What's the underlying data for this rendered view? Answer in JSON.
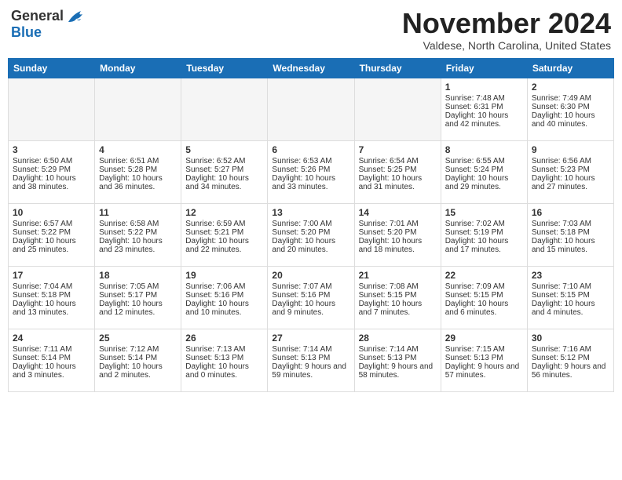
{
  "header": {
    "logo_general": "General",
    "logo_blue": "Blue",
    "month_title": "November 2024",
    "location": "Valdese, North Carolina, United States"
  },
  "weekdays": [
    "Sunday",
    "Monday",
    "Tuesday",
    "Wednesday",
    "Thursday",
    "Friday",
    "Saturday"
  ],
  "weeks": [
    [
      {
        "day": "",
        "sunrise": "",
        "sunset": "",
        "daylight": "",
        "empty": true
      },
      {
        "day": "",
        "sunrise": "",
        "sunset": "",
        "daylight": "",
        "empty": true
      },
      {
        "day": "",
        "sunrise": "",
        "sunset": "",
        "daylight": "",
        "empty": true
      },
      {
        "day": "",
        "sunrise": "",
        "sunset": "",
        "daylight": "",
        "empty": true
      },
      {
        "day": "",
        "sunrise": "",
        "sunset": "",
        "daylight": "",
        "empty": true
      },
      {
        "day": "1",
        "sunrise": "Sunrise: 7:48 AM",
        "sunset": "Sunset: 6:31 PM",
        "daylight": "Daylight: 10 hours and 42 minutes.",
        "empty": false
      },
      {
        "day": "2",
        "sunrise": "Sunrise: 7:49 AM",
        "sunset": "Sunset: 6:30 PM",
        "daylight": "Daylight: 10 hours and 40 minutes.",
        "empty": false
      }
    ],
    [
      {
        "day": "3",
        "sunrise": "Sunrise: 6:50 AM",
        "sunset": "Sunset: 5:29 PM",
        "daylight": "Daylight: 10 hours and 38 minutes.",
        "empty": false
      },
      {
        "day": "4",
        "sunrise": "Sunrise: 6:51 AM",
        "sunset": "Sunset: 5:28 PM",
        "daylight": "Daylight: 10 hours and 36 minutes.",
        "empty": false
      },
      {
        "day": "5",
        "sunrise": "Sunrise: 6:52 AM",
        "sunset": "Sunset: 5:27 PM",
        "daylight": "Daylight: 10 hours and 34 minutes.",
        "empty": false
      },
      {
        "day": "6",
        "sunrise": "Sunrise: 6:53 AM",
        "sunset": "Sunset: 5:26 PM",
        "daylight": "Daylight: 10 hours and 33 minutes.",
        "empty": false
      },
      {
        "day": "7",
        "sunrise": "Sunrise: 6:54 AM",
        "sunset": "Sunset: 5:25 PM",
        "daylight": "Daylight: 10 hours and 31 minutes.",
        "empty": false
      },
      {
        "day": "8",
        "sunrise": "Sunrise: 6:55 AM",
        "sunset": "Sunset: 5:24 PM",
        "daylight": "Daylight: 10 hours and 29 minutes.",
        "empty": false
      },
      {
        "day": "9",
        "sunrise": "Sunrise: 6:56 AM",
        "sunset": "Sunset: 5:23 PM",
        "daylight": "Daylight: 10 hours and 27 minutes.",
        "empty": false
      }
    ],
    [
      {
        "day": "10",
        "sunrise": "Sunrise: 6:57 AM",
        "sunset": "Sunset: 5:22 PM",
        "daylight": "Daylight: 10 hours and 25 minutes.",
        "empty": false
      },
      {
        "day": "11",
        "sunrise": "Sunrise: 6:58 AM",
        "sunset": "Sunset: 5:22 PM",
        "daylight": "Daylight: 10 hours and 23 minutes.",
        "empty": false
      },
      {
        "day": "12",
        "sunrise": "Sunrise: 6:59 AM",
        "sunset": "Sunset: 5:21 PM",
        "daylight": "Daylight: 10 hours and 22 minutes.",
        "empty": false
      },
      {
        "day": "13",
        "sunrise": "Sunrise: 7:00 AM",
        "sunset": "Sunset: 5:20 PM",
        "daylight": "Daylight: 10 hours and 20 minutes.",
        "empty": false
      },
      {
        "day": "14",
        "sunrise": "Sunrise: 7:01 AM",
        "sunset": "Sunset: 5:20 PM",
        "daylight": "Daylight: 10 hours and 18 minutes.",
        "empty": false
      },
      {
        "day": "15",
        "sunrise": "Sunrise: 7:02 AM",
        "sunset": "Sunset: 5:19 PM",
        "daylight": "Daylight: 10 hours and 17 minutes.",
        "empty": false
      },
      {
        "day": "16",
        "sunrise": "Sunrise: 7:03 AM",
        "sunset": "Sunset: 5:18 PM",
        "daylight": "Daylight: 10 hours and 15 minutes.",
        "empty": false
      }
    ],
    [
      {
        "day": "17",
        "sunrise": "Sunrise: 7:04 AM",
        "sunset": "Sunset: 5:18 PM",
        "daylight": "Daylight: 10 hours and 13 minutes.",
        "empty": false
      },
      {
        "day": "18",
        "sunrise": "Sunrise: 7:05 AM",
        "sunset": "Sunset: 5:17 PM",
        "daylight": "Daylight: 10 hours and 12 minutes.",
        "empty": false
      },
      {
        "day": "19",
        "sunrise": "Sunrise: 7:06 AM",
        "sunset": "Sunset: 5:16 PM",
        "daylight": "Daylight: 10 hours and 10 minutes.",
        "empty": false
      },
      {
        "day": "20",
        "sunrise": "Sunrise: 7:07 AM",
        "sunset": "Sunset: 5:16 PM",
        "daylight": "Daylight: 10 hours and 9 minutes.",
        "empty": false
      },
      {
        "day": "21",
        "sunrise": "Sunrise: 7:08 AM",
        "sunset": "Sunset: 5:15 PM",
        "daylight": "Daylight: 10 hours and 7 minutes.",
        "empty": false
      },
      {
        "day": "22",
        "sunrise": "Sunrise: 7:09 AM",
        "sunset": "Sunset: 5:15 PM",
        "daylight": "Daylight: 10 hours and 6 minutes.",
        "empty": false
      },
      {
        "day": "23",
        "sunrise": "Sunrise: 7:10 AM",
        "sunset": "Sunset: 5:15 PM",
        "daylight": "Daylight: 10 hours and 4 minutes.",
        "empty": false
      }
    ],
    [
      {
        "day": "24",
        "sunrise": "Sunrise: 7:11 AM",
        "sunset": "Sunset: 5:14 PM",
        "daylight": "Daylight: 10 hours and 3 minutes.",
        "empty": false
      },
      {
        "day": "25",
        "sunrise": "Sunrise: 7:12 AM",
        "sunset": "Sunset: 5:14 PM",
        "daylight": "Daylight: 10 hours and 2 minutes.",
        "empty": false
      },
      {
        "day": "26",
        "sunrise": "Sunrise: 7:13 AM",
        "sunset": "Sunset: 5:13 PM",
        "daylight": "Daylight: 10 hours and 0 minutes.",
        "empty": false
      },
      {
        "day": "27",
        "sunrise": "Sunrise: 7:14 AM",
        "sunset": "Sunset: 5:13 PM",
        "daylight": "Daylight: 9 hours and 59 minutes.",
        "empty": false
      },
      {
        "day": "28",
        "sunrise": "Sunrise: 7:14 AM",
        "sunset": "Sunset: 5:13 PM",
        "daylight": "Daylight: 9 hours and 58 minutes.",
        "empty": false
      },
      {
        "day": "29",
        "sunrise": "Sunrise: 7:15 AM",
        "sunset": "Sunset: 5:13 PM",
        "daylight": "Daylight: 9 hours and 57 minutes.",
        "empty": false
      },
      {
        "day": "30",
        "sunrise": "Sunrise: 7:16 AM",
        "sunset": "Sunset: 5:12 PM",
        "daylight": "Daylight: 9 hours and 56 minutes.",
        "empty": false
      }
    ]
  ]
}
